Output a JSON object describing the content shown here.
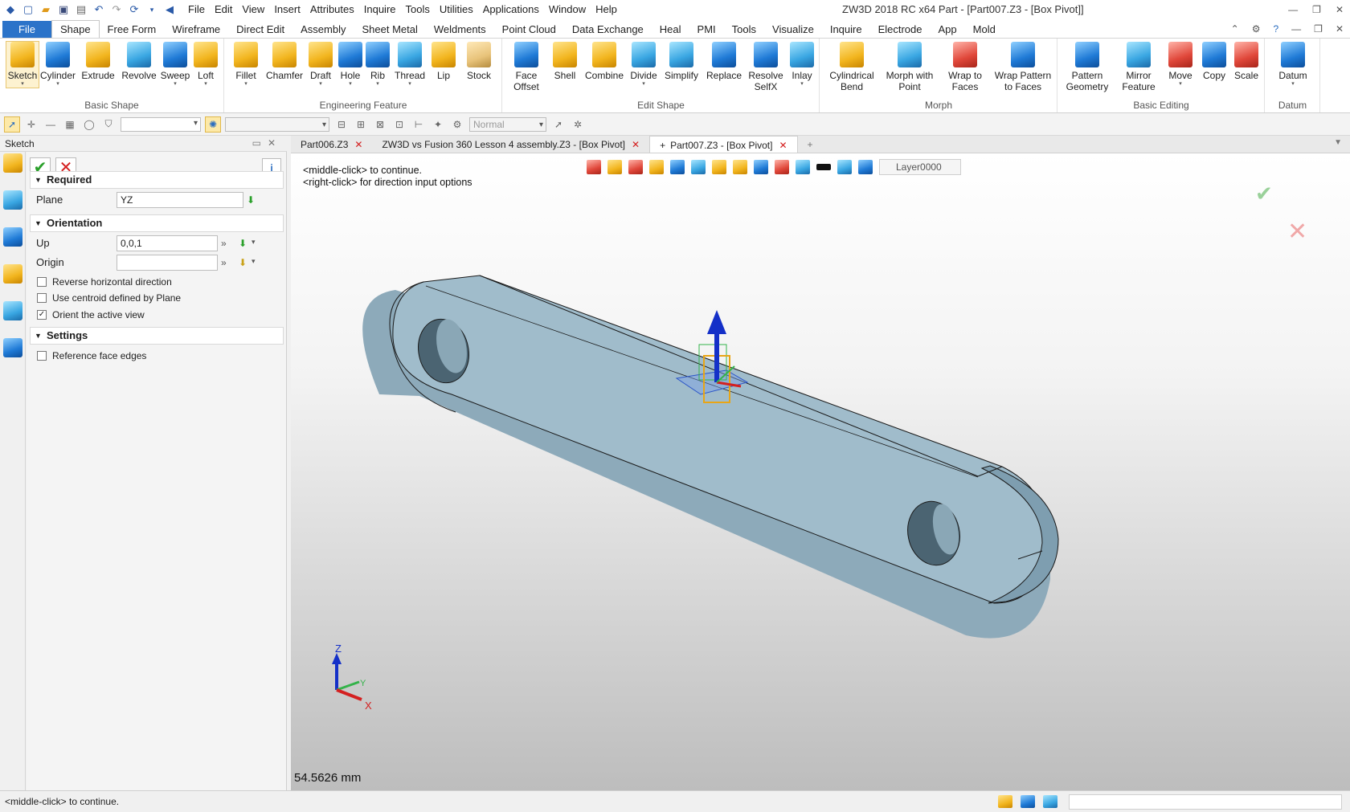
{
  "titlebar": {
    "menu": [
      "File",
      "Edit",
      "View",
      "Insert",
      "Attributes",
      "Inquire",
      "Tools",
      "Utilities",
      "Applications",
      "Window",
      "Help"
    ],
    "title": "ZW3D 2018 RC x64       Part - [Part007.Z3 - [Box Pivot]]"
  },
  "ribbon_tabs": [
    "File",
    "Shape",
    "Free Form",
    "Wireframe",
    "Direct Edit",
    "Assembly",
    "Sheet Metal",
    "Weldments",
    "Point Cloud",
    "Data Exchange",
    "Heal",
    "PMI",
    "Tools",
    "Visualize",
    "Inquire",
    "Electrode",
    "App",
    "Mold"
  ],
  "ribbon": {
    "basic_shape": {
      "label": "Basic Shape",
      "buttons": [
        "Sketch",
        "Cylinder",
        "Extrude",
        "Revolve",
        "Sweep",
        "Loft"
      ]
    },
    "engineering_feature": {
      "label": "Engineering Feature",
      "buttons": [
        "Fillet",
        "Chamfer",
        "Draft",
        "Hole",
        "Rib",
        "Thread",
        "Lip",
        "Stock"
      ]
    },
    "edit_shape": {
      "label": "Edit Shape",
      "buttons": [
        "Face\nOffset",
        "Shell",
        "Combine",
        "Divide",
        "Simplify",
        "Replace",
        "Resolve\nSelfX",
        "Inlay"
      ]
    },
    "morph": {
      "label": "Morph",
      "buttons": [
        "Cylindrical\nBend",
        "Morph with\nPoint",
        "Wrap to\nFaces",
        "Wrap Pattern\nto Faces"
      ]
    },
    "basic_editing": {
      "label": "Basic Editing",
      "buttons": [
        "Pattern\nGeometry",
        "Mirror\nFeature",
        "Move",
        "Copy",
        "Scale"
      ]
    },
    "datum": {
      "label": "Datum",
      "buttons": [
        "Datum"
      ]
    }
  },
  "toolbar": {
    "render_mode": "Normal"
  },
  "panel": {
    "title": "Sketch",
    "required_label": "Required",
    "plane_label": "Plane",
    "plane_value": "YZ",
    "orientation_label": "Orientation",
    "up_label": "Up",
    "up_value": "0,0,1",
    "origin_label": "Origin",
    "origin_value": "",
    "reverse_horizontal": "Reverse horizontal direction",
    "use_centroid": "Use centroid defined by Plane",
    "orient_active_view": "Orient the active view",
    "orient_checked": "✓",
    "settings_label": "Settings",
    "reference_face_edges": "Reference face edges"
  },
  "doc_tabs": [
    {
      "label": "Part006.Z3"
    },
    {
      "label": "ZW3D vs Fusion 360 Lesson 4 assembly.Z3 - [Box Pivot]"
    },
    {
      "label": "Part007.Z3 - [Box Pivot]"
    }
  ],
  "viewport": {
    "layer": "Layer0000",
    "hint1": "<middle-click> to continue.",
    "hint2": "<right-click> for direction input options",
    "distance": "54.5626 mm",
    "axis_z": "Z",
    "axis_y": "Y",
    "axis_x": "X"
  },
  "status": {
    "message": "<middle-click> to continue."
  },
  "colors": {
    "accent": "#2b73c9",
    "model": "#9ab8c6",
    "ok": "#2aa02a",
    "cancel": "#d42020"
  }
}
